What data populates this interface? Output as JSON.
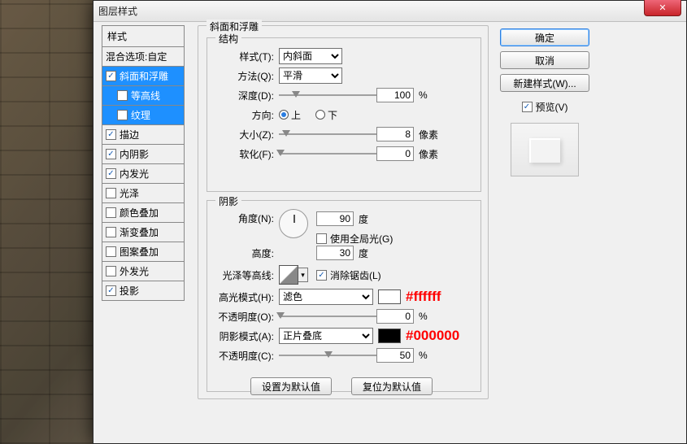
{
  "window": {
    "title": "图层样式"
  },
  "styles": {
    "header": "样式",
    "blend": "混合选项:自定",
    "items": [
      {
        "label": "斜面和浮雕",
        "checked": true,
        "selected": true
      },
      {
        "label": "等高线",
        "checked": false,
        "child": true
      },
      {
        "label": "纹理",
        "checked": false,
        "child": true
      },
      {
        "label": "描边",
        "checked": true
      },
      {
        "label": "内阴影",
        "checked": true
      },
      {
        "label": "内发光",
        "checked": true
      },
      {
        "label": "光泽",
        "checked": false
      },
      {
        "label": "颜色叠加",
        "checked": false
      },
      {
        "label": "渐变叠加",
        "checked": false
      },
      {
        "label": "图案叠加",
        "checked": false
      },
      {
        "label": "外发光",
        "checked": false
      },
      {
        "label": "投影",
        "checked": true
      }
    ]
  },
  "main": {
    "legend": "斜面和浮雕",
    "struct_legend": "结构",
    "shade_legend": "阴影",
    "style_label": "样式(T):",
    "style_value": "内斜面",
    "technique_label": "方法(Q):",
    "technique_value": "平滑",
    "depth_label": "深度(D):",
    "depth_value": "100",
    "depth_unit": "%",
    "direction_label": "方向:",
    "dir_up": "上",
    "dir_down": "下",
    "size_label": "大小(Z):",
    "size_value": "8",
    "size_unit": "像素",
    "soften_label": "软化(F):",
    "soften_value": "0",
    "soften_unit": "像素",
    "angle_label": "角度(N):",
    "angle_value": "90",
    "angle_unit": "度",
    "global_light": "使用全局光(G)",
    "altitude_label": "高度:",
    "altitude_value": "30",
    "altitude_unit": "度",
    "contour_label": "光泽等高线:",
    "anti_alias": "消除锯齿(L)",
    "highlight_label": "高光模式(H):",
    "highlight_value": "滤色",
    "highlight_color": "#ffffff",
    "highlight_annot": "#ffffff",
    "hl_opacity_label": "不透明度(O):",
    "hl_opacity_value": "0",
    "hl_opacity_unit": "%",
    "shadow_label": "阴影模式(A):",
    "shadow_value": "正片叠底",
    "shadow_color": "#000000",
    "shadow_annot": "#000000",
    "sh_opacity_label": "不透明度(C):",
    "sh_opacity_value": "50",
    "sh_opacity_unit": "%",
    "make_default": "设置为默认值",
    "reset_default": "复位为默认值"
  },
  "right": {
    "ok": "确定",
    "cancel": "取消",
    "new_style": "新建样式(W)...",
    "preview": "预览(V)"
  }
}
